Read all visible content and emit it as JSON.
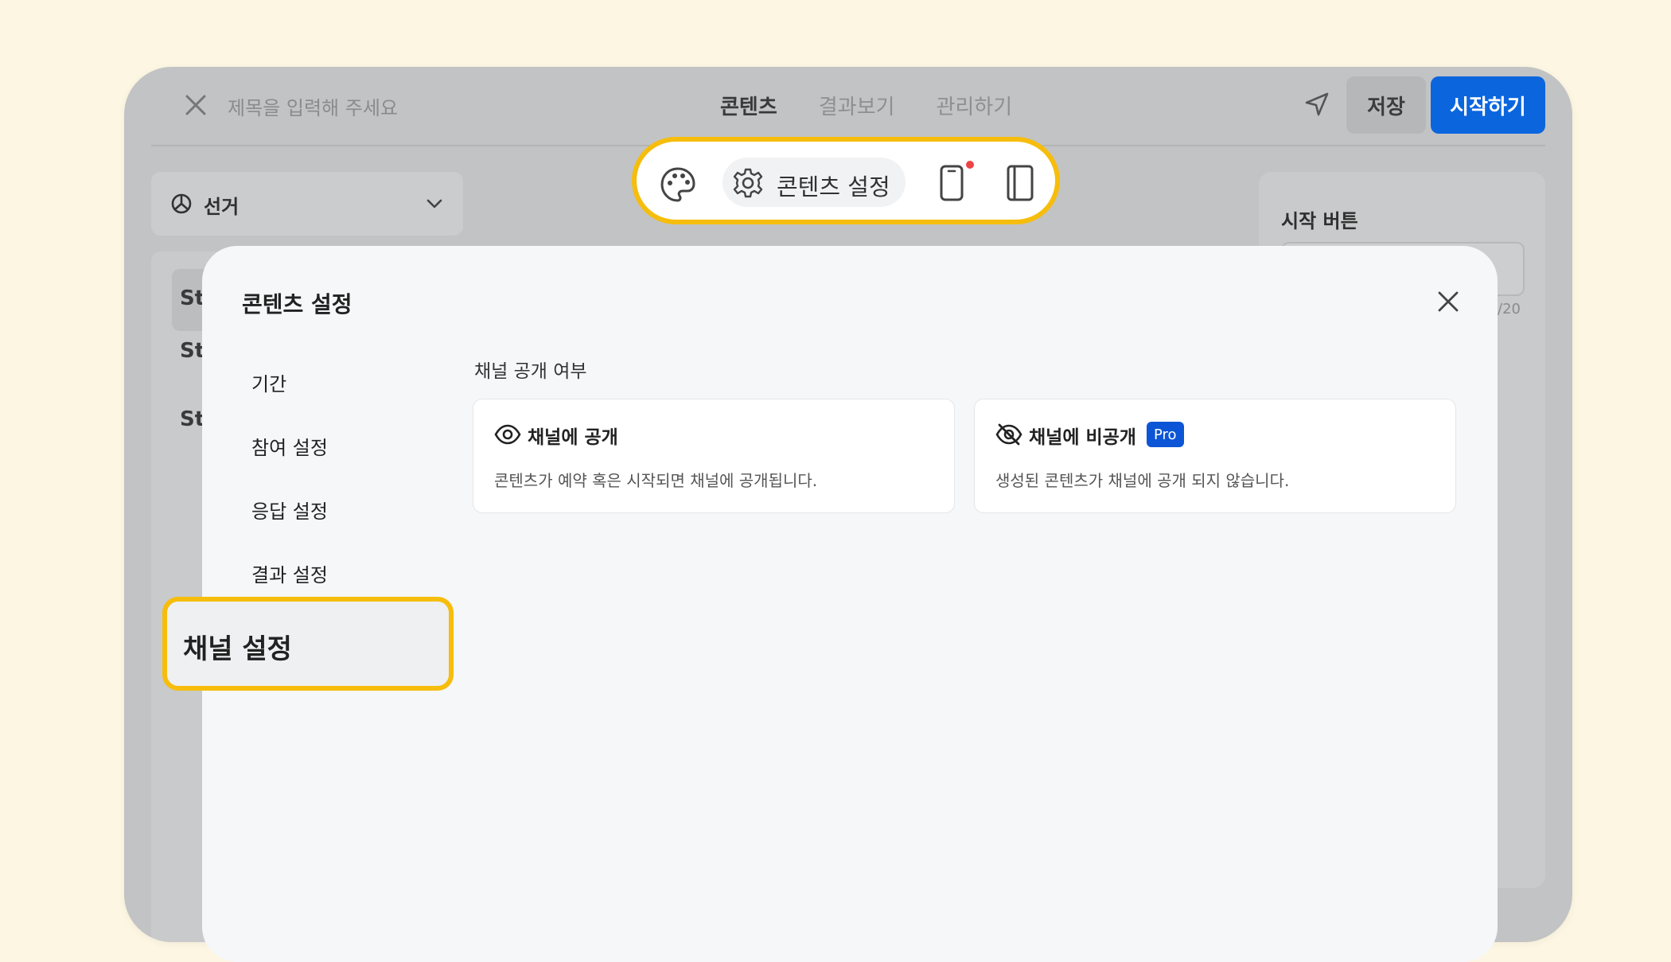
{
  "topbar": {
    "title_placeholder": "제목을 입력해 주세요",
    "tabs": [
      {
        "label": "콘텐츠",
        "active": true
      },
      {
        "label": "결과보기",
        "active": false
      },
      {
        "label": "관리하기",
        "active": false
      }
    ],
    "save_label": "저장",
    "start_label": "시작하기"
  },
  "left_panel": {
    "select_label": "선거",
    "items": [
      "St",
      "St",
      "St"
    ]
  },
  "right_panel": {
    "title": "시작 버튼",
    "counter": "/20"
  },
  "toolbar": {
    "settings_label": "콘텐츠 설정",
    "icons": [
      "palette-icon",
      "gear-icon",
      "mobile-icon",
      "book-icon"
    ],
    "notification_color": "#ef4444"
  },
  "modal": {
    "title": "콘텐츠 설정",
    "nav": [
      {
        "label": "기간"
      },
      {
        "label": "참여 설정"
      },
      {
        "label": "응답 설정"
      },
      {
        "label": "결과 설정"
      },
      {
        "label": "채널 설정",
        "highlighted": true
      }
    ],
    "section_label": "채널 공개 여부",
    "options": [
      {
        "title": "채널에 공개",
        "description": "콘텐츠가 예약 혹은 시작되면 채널에 공개됩니다.",
        "icon": "eye-icon"
      },
      {
        "title": "채널에 비공개",
        "description": "생성된 콘텐츠가 채널에 공개 되지 않습니다.",
        "icon": "eye-off-icon",
        "badge": "Pro"
      }
    ]
  },
  "colors": {
    "page_bg": "#fdf6e3",
    "highlight": "#f6bd0c",
    "primary": "#0b66de",
    "pro_badge": "#0b55d6"
  }
}
